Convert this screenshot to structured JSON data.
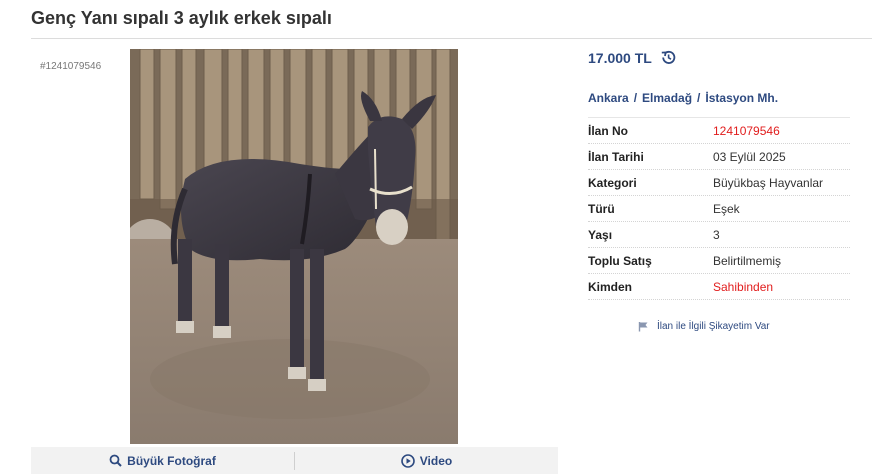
{
  "listing": {
    "title": "Genç Yanı sıpalı 3 aylık erkek sıpalı",
    "id_label": "#1241079546"
  },
  "price": {
    "value": "17.000 TL",
    "history_icon": "history-icon"
  },
  "location": {
    "city": "Ankara",
    "district": "Elmadağ",
    "neighborhood": "İstasyon Mh.",
    "separator": "/"
  },
  "details": [
    {
      "label": "İlan No",
      "value": "1241079546",
      "highlight": true
    },
    {
      "label": "İlan Tarihi",
      "value": "03 Eylül 2025",
      "highlight": false
    },
    {
      "label": "Kategori",
      "value": "Büyükbaş Hayvanlar",
      "highlight": false
    },
    {
      "label": "Türü",
      "value": "Eşek",
      "highlight": false
    },
    {
      "label": "Yaşı",
      "value": "3",
      "highlight": false
    },
    {
      "label": "Toplu Satış",
      "value": "Belirtilmemiş",
      "highlight": false
    },
    {
      "label": "Kimden",
      "value": "Sahibinden",
      "highlight": true
    }
  ],
  "photo_bar": {
    "large_photo_label": "Büyük Fotoğraf",
    "video_label": "Video"
  },
  "report": {
    "label": "İlan ile İlgili Şikayetim Var",
    "icon": "flag-icon"
  },
  "colors": {
    "link_blue": "#2e4a80",
    "highlight_red": "#e11d1d"
  }
}
